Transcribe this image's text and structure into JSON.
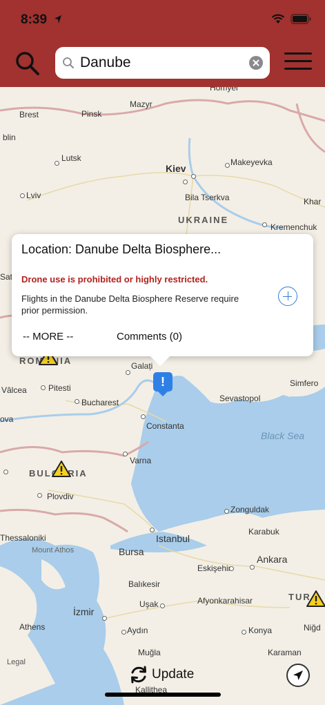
{
  "status_bar": {
    "time": "8:39"
  },
  "search": {
    "value": "Danube",
    "placeholder": ""
  },
  "popup": {
    "title": "Location: Danube Delta Biosphere...",
    "warning": "Drone use is prohibited or highly restricted.",
    "description": "Flights in the Danube Delta Biosphere Reserve require prior permission.",
    "more_label": "-- MORE --",
    "comments_label": "Comments (0)"
  },
  "map": {
    "cities": [
      "Homyel",
      "Mazyr",
      "Brest",
      "Pinsk",
      "blin",
      "Lutsk",
      "Kiev",
      "Makeyevka",
      "Lviv",
      "Bila Tserkva",
      "Khar",
      "Kremenchuk",
      "Sat",
      "Galați",
      "Vâlcea",
      "Pitesti",
      "Simfero",
      "Sevastopol",
      "Bucharest",
      "ova",
      "Constanta",
      "Varna",
      "Plovdiv",
      "Zonguldak",
      "Karabuk",
      "Thessaloniki",
      "Mount Athos",
      "Istanbul",
      "Bursa",
      "Eskişehir",
      "Ankara",
      "Balıkesir",
      "Uşak",
      "Afyonkarahisar",
      "İzmir",
      "Athens",
      "Aydın",
      "Konya",
      "Muğla",
      "Karaman",
      "Niğd",
      "Kallithea"
    ],
    "countries": [
      "UKRAINE",
      "ROMANIA",
      "BULGARIA",
      "TUR"
    ],
    "sea": "Black Sea",
    "legal": "Legal"
  },
  "bottom": {
    "update_label": "Update"
  },
  "colors": {
    "header": "#a1322f",
    "accent": "#2f80e6",
    "warning": "#b3211d",
    "land": "#f3efe6",
    "water": "#a9cdea"
  },
  "icons": [
    "location-arrow-icon",
    "wifi-icon",
    "battery-icon",
    "search-icon",
    "magnifier-icon",
    "clear-icon",
    "menu-icon",
    "alert-pin-icon",
    "warning-triangle-icon",
    "add-circle-icon",
    "refresh-icon",
    "compass-icon"
  ]
}
